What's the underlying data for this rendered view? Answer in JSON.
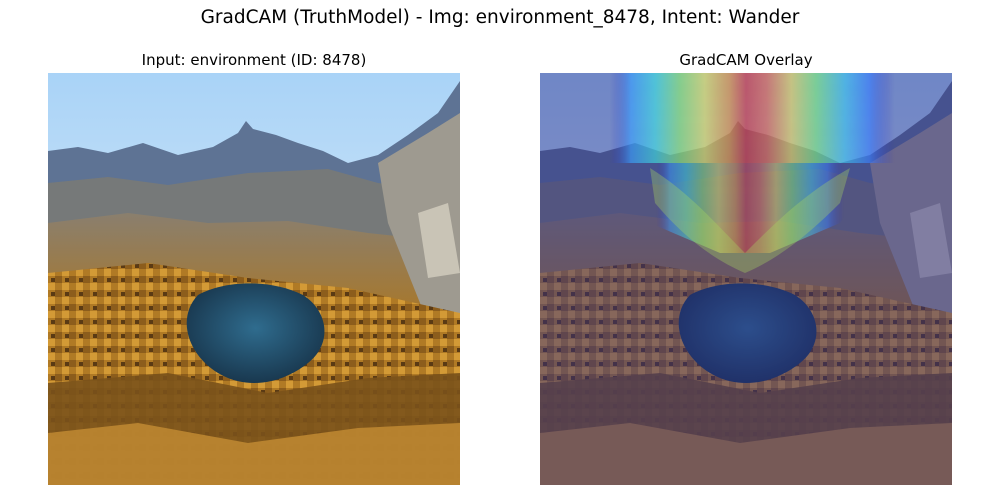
{
  "figure": {
    "title": "GradCAM (TruthModel) - Img: environment_8478, Intent: Wander"
  },
  "panels": [
    {
      "title": "Input: environment (ID: 8478)",
      "content": "landscape-photo"
    },
    {
      "title": "GradCAM Overlay",
      "content": "landscape-photo-with-heatmap",
      "colormap": "jet",
      "heatmap_focus": "upper-center sky and mountain peak"
    }
  ],
  "colors": {
    "sky_top": "#a9d3f7",
    "sky_bottom": "#eef4f8",
    "mountain": "#5e7394",
    "foliage": "#c68a2c",
    "lake": "#244c6b",
    "overlay_tint": "#2a2a8a"
  }
}
